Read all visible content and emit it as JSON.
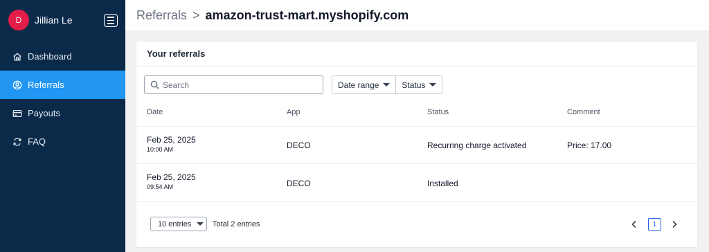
{
  "user": {
    "initial": "D",
    "name": "Jillian Le"
  },
  "nav": {
    "items": [
      {
        "label": "Dashboard",
        "icon": "home-icon"
      },
      {
        "label": "Referrals",
        "icon": "user-circle-icon",
        "active": true
      },
      {
        "label": "Payouts",
        "icon": "credit-card-icon"
      },
      {
        "label": "FAQ",
        "icon": "refresh-icon"
      }
    ]
  },
  "breadcrumb": {
    "root": "Referrals",
    "separator": ">",
    "current": "amazon-trust-mart.myshopify.com"
  },
  "card": {
    "title": "Your referrals",
    "search_placeholder": "Search",
    "filters": {
      "date_range": "Date range",
      "status": "Status"
    },
    "columns": [
      "Date",
      "App",
      "Status",
      "Comment"
    ],
    "rows": [
      {
        "date": "Feb 25, 2025",
        "time": "10:00 AM",
        "app": "DECO",
        "status": "Recurring charge activated",
        "comment": "Price: 17.00"
      },
      {
        "date": "Feb 25, 2025",
        "time": "09:54 AM",
        "app": "DECO",
        "status": "Installed",
        "comment": ""
      }
    ],
    "entries_label": "10 entries",
    "total_label": "Total 2 entries",
    "current_page": "1"
  },
  "colors": {
    "sidebar": "#0b2a4a",
    "accent": "#2196f3",
    "avatar": "#e11d48",
    "pager": "#2563eb"
  }
}
